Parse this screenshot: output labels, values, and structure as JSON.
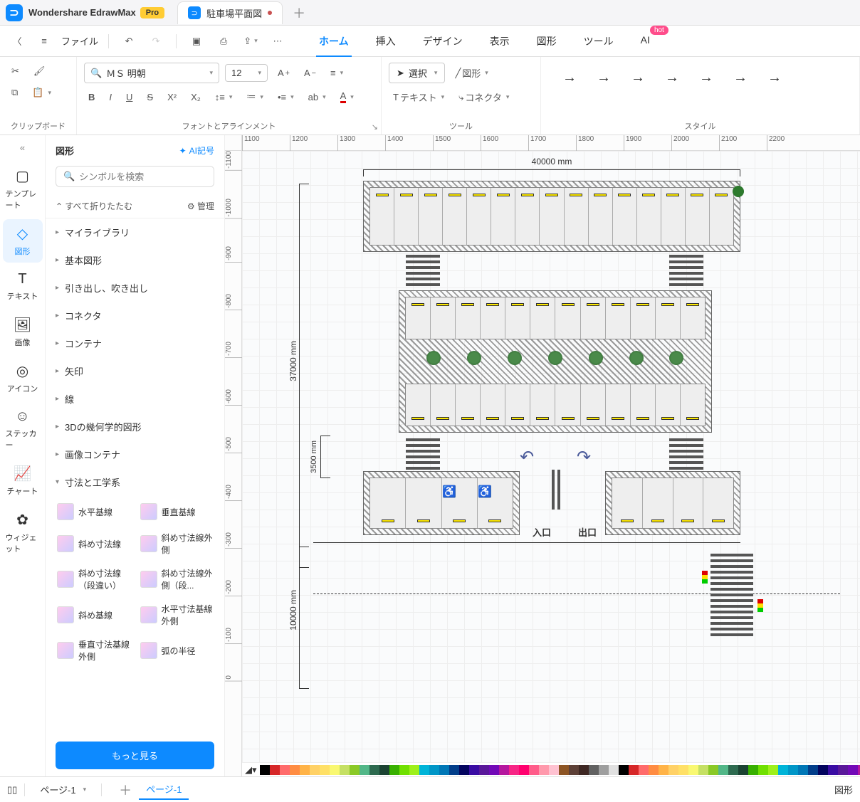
{
  "titlebar": {
    "brand": "Wondershare EdrawMax",
    "pro_badge": "Pro",
    "doc_title": "駐車場平面図",
    "modified": true
  },
  "menubar": {
    "file": "ファイル",
    "tabs": [
      "ホーム",
      "挿入",
      "デザイン",
      "表示",
      "図形",
      "ツール",
      "AI"
    ],
    "active_tab": 0,
    "hot_label": "hot"
  },
  "ribbon": {
    "clipboard_label": "クリップボード",
    "font_label": "フォントとアラインメント",
    "tools_label": "ツール",
    "style_label": "スタイル",
    "font_name": "ＭＳ 明朝",
    "font_size": "12",
    "select_btn": "選択",
    "shape_btn": "図形",
    "text_btn": "テキスト",
    "connector_btn": "コネクタ"
  },
  "sidebar_narrow": {
    "items": [
      {
        "label": "テンプレート"
      },
      {
        "label": "図形"
      },
      {
        "label": "テキスト"
      },
      {
        "label": "画像"
      },
      {
        "label": "アイコン"
      },
      {
        "label": "ステッカー"
      },
      {
        "label": "チャート"
      },
      {
        "label": "ウィジェット"
      }
    ],
    "active": 1
  },
  "shapes_panel": {
    "title": "図形",
    "ai_link": "AI記号",
    "search_placeholder": "シンボルを検索",
    "collapse_all": "すべて折りたたむ",
    "manage": "管理",
    "categories": [
      "マイライブラリ",
      "基本図形",
      "引き出し、吹き出し",
      "コネクタ",
      "コンテナ",
      "矢印",
      "線",
      "3Dの幾何学的図形",
      "画像コンテナ",
      "寸法と工学系"
    ],
    "shapes": [
      {
        "label": "水平基線"
      },
      {
        "label": "垂直基線"
      },
      {
        "label": "斜め寸法線"
      },
      {
        "label": "斜め寸法線外側"
      },
      {
        "label": "斜め寸法線（段違い）"
      },
      {
        "label": "斜め寸法線外側（段..."
      },
      {
        "label": "斜め基線"
      },
      {
        "label": "水平寸法基線外側"
      },
      {
        "label": "垂直寸法基線外側"
      },
      {
        "label": "弧の半径"
      }
    ],
    "more_btn": "もっと見る"
  },
  "ruler": {
    "h_ticks": [
      "1100",
      "1200",
      "1300",
      "1400",
      "1500",
      "1600",
      "1700",
      "1800",
      "1900",
      "2000",
      "2100",
      "2200"
    ],
    "v_ticks": [
      "-1100",
      "-1000",
      "-900",
      "-800",
      "-700",
      "-600",
      "-500",
      "-400",
      "-300",
      "-200",
      "-100",
      "0"
    ]
  },
  "drawing": {
    "width_label": "40000 mm",
    "height_label": "37000 mm",
    "gap_label": "3500 mm",
    "road_label": "10000 mm",
    "entry_label": "入口",
    "exit_label": "出口"
  },
  "statusbar": {
    "page_select": "ページ-1",
    "page_tab": "ページ-1",
    "right_label": "図形"
  },
  "color_palette": [
    "#000",
    "#d62728",
    "#ff6b6b",
    "#ff8c42",
    "#ffb347",
    "#ffd166",
    "#ffe066",
    "#f9f871",
    "#c5e063",
    "#8ac926",
    "#52b788",
    "#2d6a4f",
    "#1b4332",
    "#38b000",
    "#70e000",
    "#9ef01a",
    "#00b4d8",
    "#0096c7",
    "#0077b6",
    "#023e8a",
    "#03045e",
    "#3a0ca3",
    "#5a189a",
    "#7209b7",
    "#b5179e",
    "#f72585",
    "#ff006e",
    "#ff5c8a",
    "#ff99ac",
    "#ffc2d1",
    "#8d5524",
    "#5d4037",
    "#3e2723",
    "#616161",
    "#9e9e9e",
    "#e0e0e0"
  ]
}
